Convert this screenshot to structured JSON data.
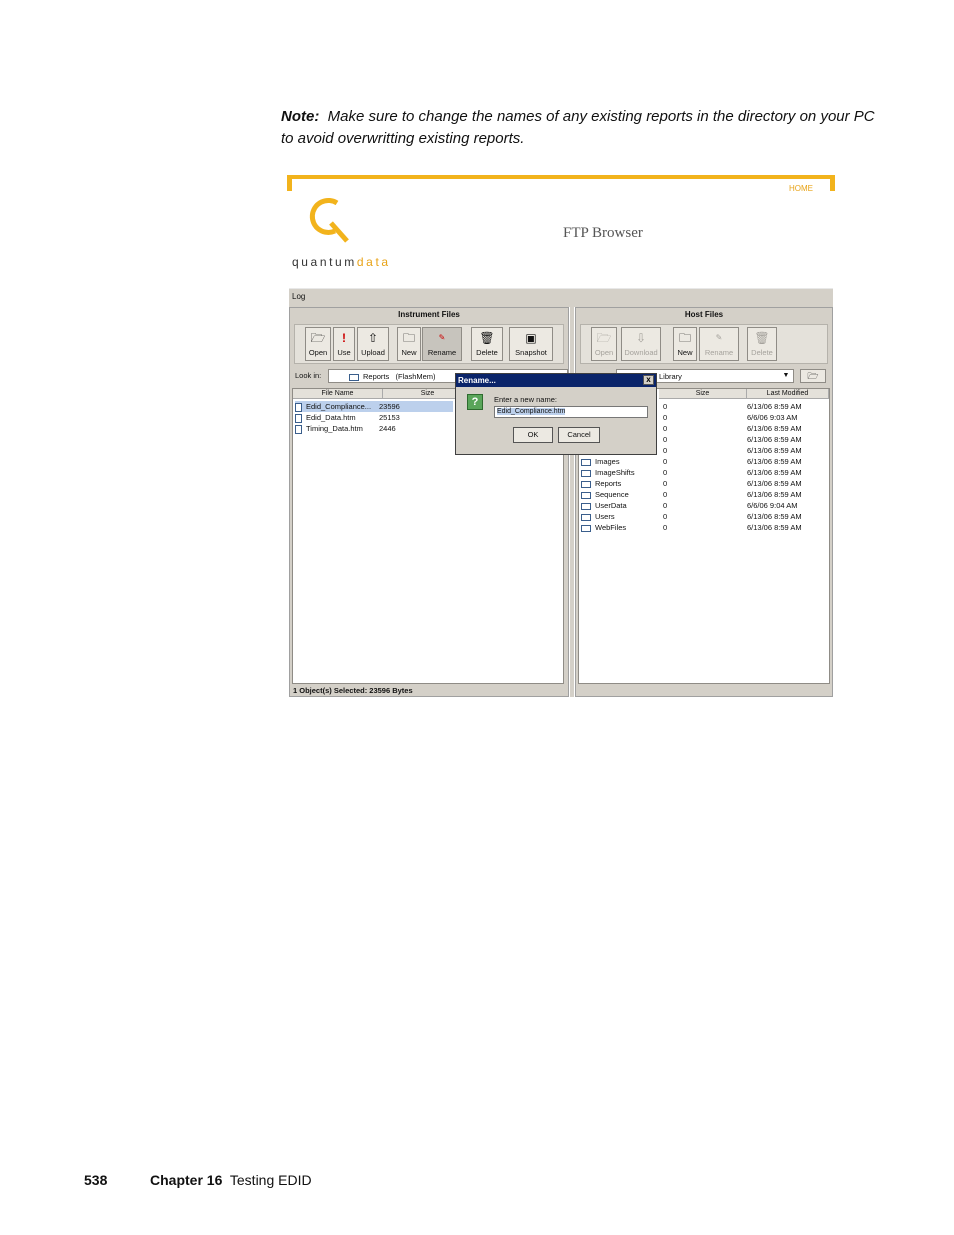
{
  "note": {
    "label": "Note:",
    "text": "Make sure to change the names of any existing reports in the directory on your PC to avoid overwritting existing reports."
  },
  "screenshot": {
    "home_link": "HOME",
    "logo_text_a": "quantum",
    "logo_text_b": "data",
    "title": "FTP Browser",
    "log_label": "Log",
    "instrument": {
      "title": "Instrument Files",
      "buttons": [
        {
          "label": "Open",
          "icon": "open-icon"
        },
        {
          "label": "Use",
          "icon": "use-icon"
        },
        {
          "label": "Upload",
          "icon": "upload-icon"
        },
        {
          "label": "New",
          "icon": "new-icon"
        },
        {
          "label": "Rename",
          "icon": "rename-icon"
        },
        {
          "label": "Delete",
          "icon": "delete-icon"
        },
        {
          "label": "Snapshot",
          "icon": "snapshot-icon"
        }
      ],
      "look_in_label": "Look in:",
      "look_in_value": "Reports",
      "look_in_extra": "(FlashMem)",
      "columns": [
        "File Name",
        "Size"
      ],
      "files": [
        {
          "name": "Edid_Compliance...",
          "size": "23596",
          "selected": true
        },
        {
          "name": "Edid_Data.htm",
          "size": "25153",
          "selected": false
        },
        {
          "name": "Timing_Data.htm",
          "size": "2446",
          "selected": false
        }
      ],
      "status": "1 Object(s) Selected:  23596 Bytes"
    },
    "host": {
      "title": "Host Files",
      "buttons": [
        {
          "label": "Open",
          "icon": "open-icon"
        },
        {
          "label": "Download",
          "icon": "download-icon"
        },
        {
          "label": "New",
          "icon": "new-icon"
        },
        {
          "label": "Rename",
          "icon": "rename-icon"
        },
        {
          "label": "Delete",
          "icon": "delete-icon"
        }
      ],
      "look_in_value": "Library",
      "columns": [
        "Size",
        "Last Modified"
      ],
      "rows": [
        {
          "name": "",
          "size": "0",
          "modified": "6/13/06 8:59 AM"
        },
        {
          "name": "",
          "size": "0",
          "modified": "6/6/06 9:03 AM"
        },
        {
          "name": "",
          "size": "0",
          "modified": "6/13/06 8:59 AM"
        },
        {
          "name": "",
          "size": "0",
          "modified": "6/13/06 8:59 AM"
        },
        {
          "name": "",
          "size": "0",
          "modified": "6/13/06 8:59 AM"
        },
        {
          "name": "Images",
          "size": "0",
          "modified": "6/13/06 8:59 AM"
        },
        {
          "name": "ImageShifts",
          "size": "0",
          "modified": "6/13/06 8:59 AM"
        },
        {
          "name": "Reports",
          "size": "0",
          "modified": "6/13/06 8:59 AM"
        },
        {
          "name": "Sequence",
          "size": "0",
          "modified": "6/13/06 8:59 AM"
        },
        {
          "name": "UserData",
          "size": "0",
          "modified": "6/6/06 9:04 AM"
        },
        {
          "name": "Users",
          "size": "0",
          "modified": "6/13/06 8:59 AM"
        },
        {
          "name": "WebFiles",
          "size": "0",
          "modified": "6/13/06 8:59 AM"
        }
      ]
    },
    "dialog": {
      "title": "Rename...",
      "close": "x",
      "prompt": "Enter a new name:",
      "value": "Edid_Compliance.htm",
      "ok": "OK",
      "cancel": "Cancel"
    }
  },
  "footer": {
    "page_number": "538",
    "chapter": "Chapter 16",
    "chapter_title": "Testing EDID"
  }
}
